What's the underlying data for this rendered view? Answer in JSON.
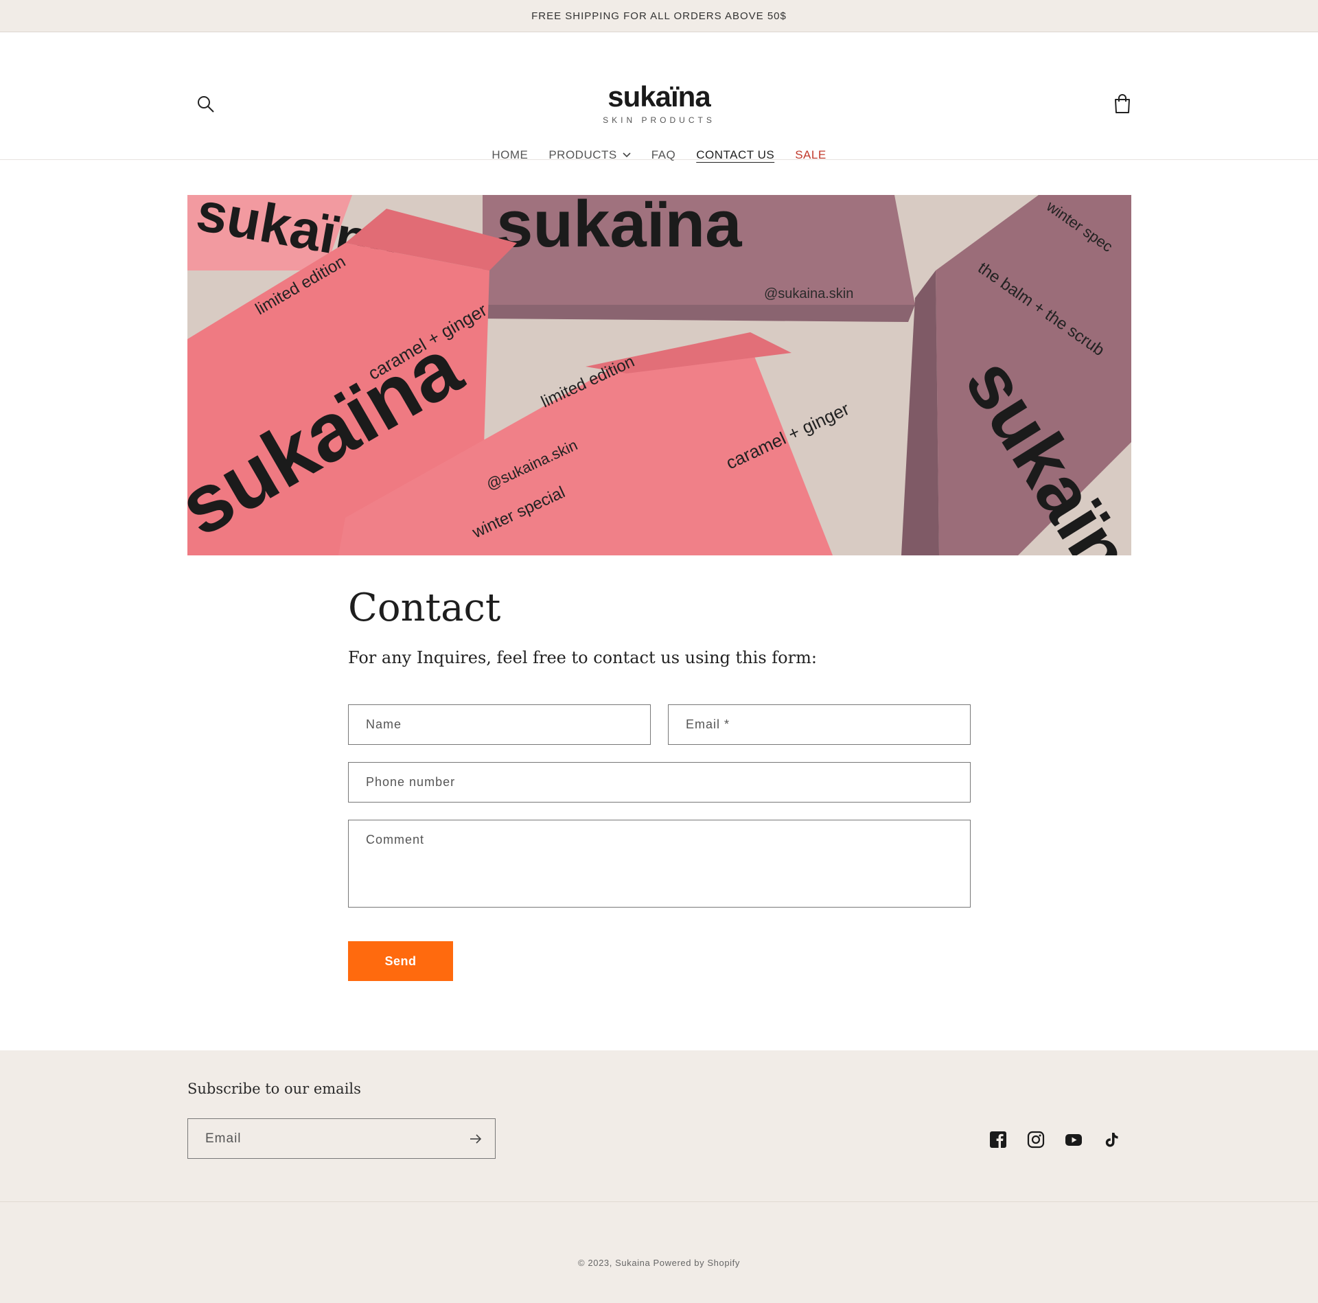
{
  "announcement": "FREE SHIPPING FOR ALL ORDERS ABOVE 50$",
  "header": {
    "logo": {
      "name": "sukaïna",
      "tagline": "SKIN PRODUCTS"
    },
    "search_icon": "search-icon",
    "cart_icon": "cart-icon"
  },
  "nav": {
    "items": [
      {
        "label": "HOME"
      },
      {
        "label": "PRODUCTS"
      },
      {
        "label": "FAQ"
      },
      {
        "label": "CONTACT US"
      },
      {
        "label": "SALE"
      }
    ],
    "sale_color": "#c0392b"
  },
  "banner": {
    "box_texts": [
      "sukaïna",
      "limited edition",
      "caramel + ginger",
      "@sukaina.skin",
      "winter special",
      "the balm + the scrub",
      "winter spec"
    ],
    "colors": {
      "pink_box": "#ef7a82",
      "mauve_box": "#a0727e",
      "surface": "#d8cbc3"
    }
  },
  "contact": {
    "title": "Contact",
    "intro": "For any Inquires, feel free to contact us using this form:",
    "fields": {
      "name": "Name",
      "email": "Email *",
      "phone": "Phone number",
      "comment": "Comment"
    },
    "send_label": "Send",
    "accent": "#ff6a0e"
  },
  "footer": {
    "subscribe_title": "Subscribe to our emails",
    "email_placeholder": "Email",
    "social": [
      "facebook-icon",
      "instagram-icon",
      "youtube-icon",
      "tiktok-icon"
    ],
    "copyright": "© 2023, Sukaina Powered by Shopify"
  }
}
